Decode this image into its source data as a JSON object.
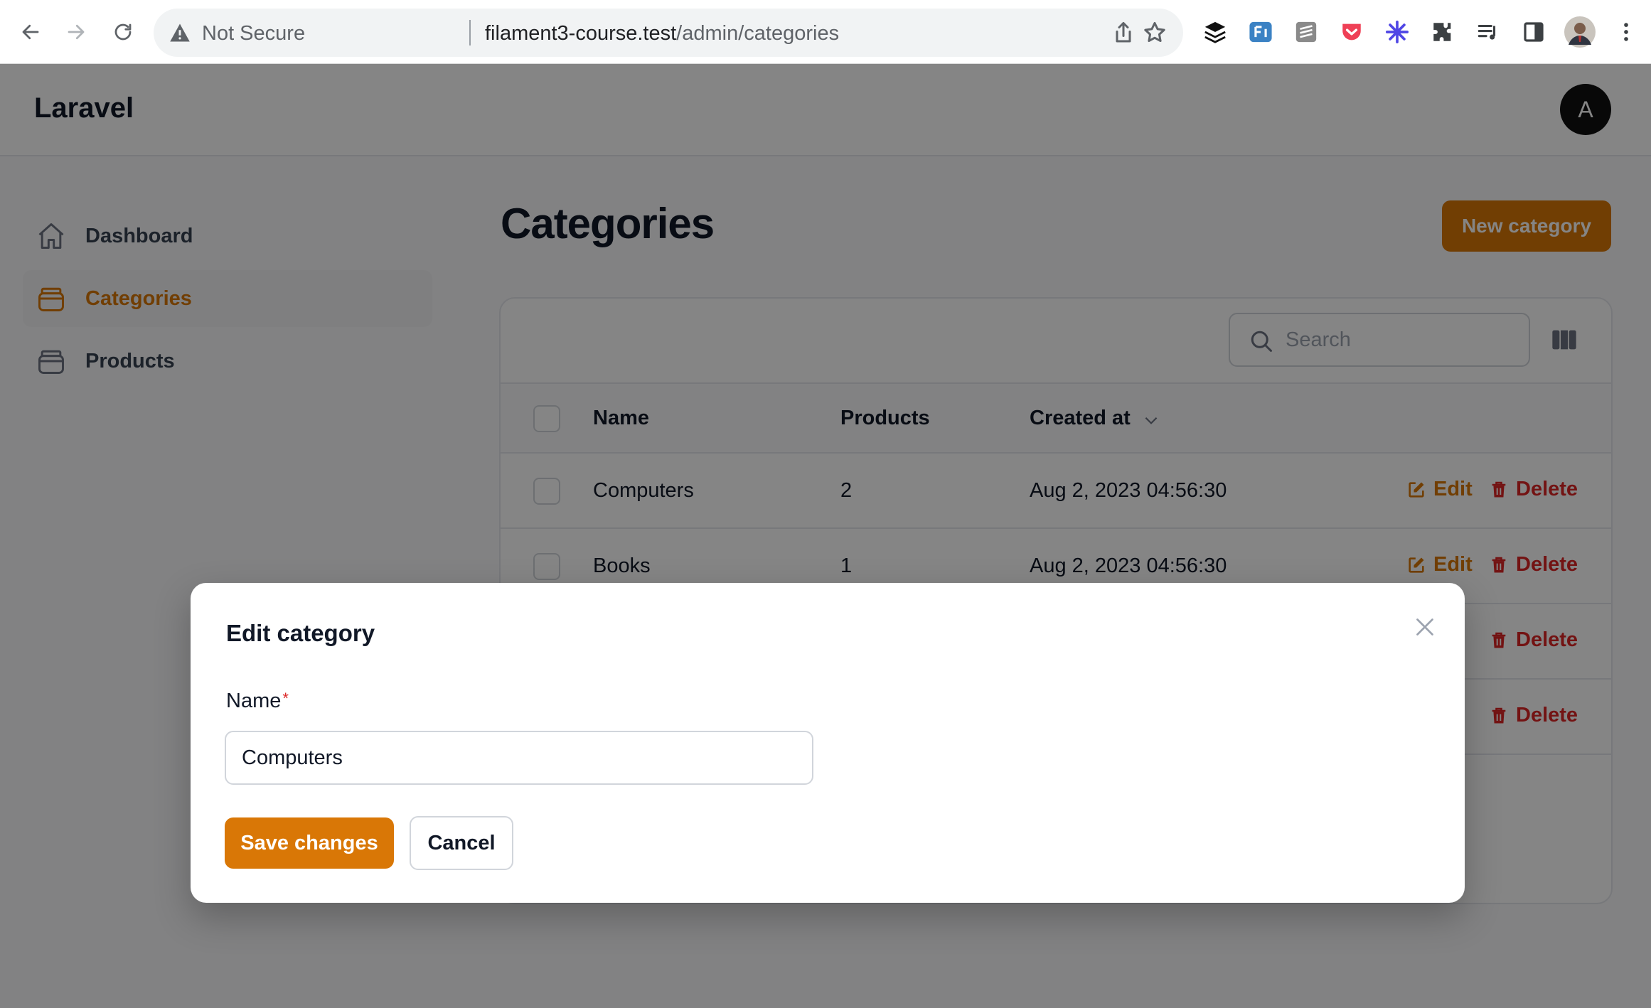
{
  "browser": {
    "security_label": "Not Secure",
    "url_host": "filament3-course.test",
    "url_path": "/admin/categories",
    "profile_icon": "user-photo-icon"
  },
  "app": {
    "brand": "Laravel",
    "avatar_initial": "A",
    "sidebar": {
      "items": [
        {
          "label": "Dashboard",
          "icon": "home-icon",
          "active": false
        },
        {
          "label": "Categories",
          "icon": "archive-box-icon",
          "active": true
        },
        {
          "label": "Products",
          "icon": "archive-box-icon",
          "active": false
        }
      ]
    },
    "page_title": "Categories",
    "new_button_label": "New category",
    "search_placeholder": "Search",
    "table": {
      "columns": [
        "Name",
        "Products",
        "Created at"
      ],
      "rows": [
        {
          "name": "Computers",
          "products": "2",
          "created_at": "Aug 2, 2023 04:56:30"
        },
        {
          "name": "Books",
          "products": "1",
          "created_at": "Aug 2, 2023 04:56:30"
        }
      ],
      "edit_label": "Edit",
      "delete_label": "Delete"
    }
  },
  "modal": {
    "title": "Edit category",
    "name_label": "Name",
    "required_marker": "*",
    "name_value": "Computers",
    "save_label": "Save changes",
    "cancel_label": "Cancel"
  },
  "colors": {
    "primary": "#d97706",
    "danger": "#dc2626",
    "text": "#111827",
    "overlay": "rgba(0,0,0,0.48)"
  }
}
